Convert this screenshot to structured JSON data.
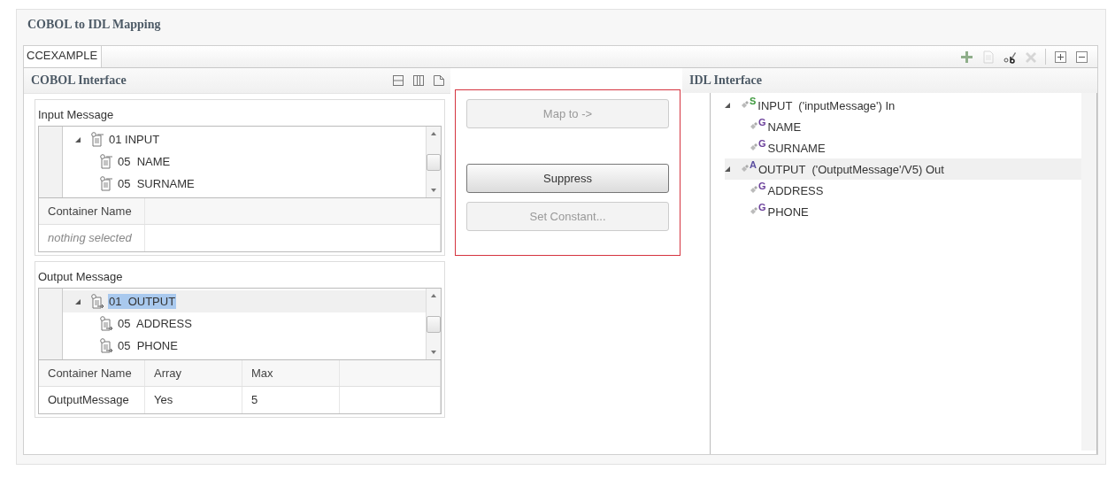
{
  "window": {
    "title": "COBOL to IDL Mapping"
  },
  "tabs": [
    {
      "label": "CCEXAMPLE",
      "selected": true
    }
  ],
  "toolbar": {
    "edit_tools": [
      {
        "kind": "add",
        "disabled": false
      },
      {
        "kind": "copy",
        "disabled": true
      },
      {
        "kind": "rename",
        "disabled": false
      },
      {
        "kind": "delete",
        "disabled": true
      }
    ],
    "tree_tools": [
      {
        "kind": "expand",
        "disabled": false
      },
      {
        "kind": "collapse",
        "disabled": false
      }
    ]
  },
  "cobol_interface": {
    "title": "COBOL Interface",
    "view_buttons": [
      {
        "kind": "horizontal"
      },
      {
        "kind": "vertical"
      },
      {
        "kind": "maximize"
      }
    ],
    "groups": [
      {
        "title": "Input Message",
        "kind": "input",
        "tree": [
          {
            "label": "01 INPUT",
            "expanded": true,
            "selected": false,
            "children": [
              {
                "label": "05  NAME",
                "selected": false
              },
              {
                "label": "05  SURNAME",
                "selected": false
              }
            ]
          }
        ],
        "table": {
          "columns": [
            "Container Name"
          ],
          "rows": [
            {
              "kind": "placeholder",
              "cells": [
                "nothing selected"
              ]
            }
          ]
        }
      },
      {
        "title": "Output Message",
        "kind": "output",
        "tree": [
          {
            "label": "01  OUTPUT",
            "expanded": true,
            "selected": true,
            "children": [
              {
                "label": "05  ADDRESS",
                "selected": false
              },
              {
                "label": "05  PHONE",
                "selected": false
              }
            ]
          }
        ],
        "table": {
          "columns": [
            "Container Name",
            "Array",
            "Max"
          ],
          "rows": [
            {
              "kind": "value",
              "cells": [
                "OutputMessage",
                "Yes",
                "5"
              ]
            }
          ]
        }
      }
    ]
  },
  "actions": [
    {
      "label": "Map to ->",
      "disabled": true,
      "focused": false
    },
    {
      "label": "Suppress",
      "disabled": false,
      "focused": true
    },
    {
      "label": "Set Constant...",
      "disabled": true,
      "focused": false
    }
  ],
  "idl_interface": {
    "title": "IDL Interface",
    "tree": [
      {
        "badge": "S",
        "color": "#3f9a3f",
        "label": "INPUT  ('inputMessage') In",
        "expanded": true,
        "hovered": false,
        "children": [
          {
            "badge": "G",
            "color": "#6a3f9a",
            "label": "NAME",
            "hovered": false
          },
          {
            "badge": "G",
            "color": "#6a3f9a",
            "label": "SURNAME",
            "hovered": false
          }
        ]
      },
      {
        "badge": "A",
        "color": "#5b4fa0",
        "label": "OUTPUT  ('OutputMessage'/V5) Out",
        "expanded": true,
        "hovered": true,
        "children": [
          {
            "badge": "G",
            "color": "#6a3f9a",
            "label": "ADDRESS",
            "hovered": false
          },
          {
            "badge": "G",
            "color": "#6a3f9a",
            "label": "PHONE",
            "hovered": false
          }
        ]
      }
    ]
  }
}
